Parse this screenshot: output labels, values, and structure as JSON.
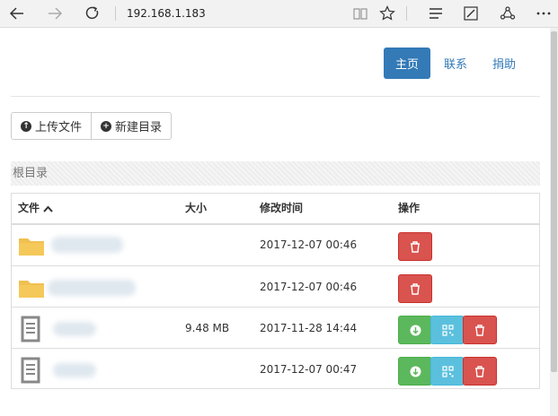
{
  "browser": {
    "address": "192.168.1.183"
  },
  "nav": {
    "home": "主页",
    "contact": "联系",
    "donate": "捐助"
  },
  "toolbar": {
    "upload_label": "上传文件",
    "new_dir_label": "新建目录"
  },
  "breadcrumb": "根目录",
  "table": {
    "headers": [
      "文件",
      "大小",
      "修改时间",
      "操作"
    ],
    "rows": [
      {
        "type": "folder",
        "size": "",
        "time": "2017-12-07 00:46",
        "actions": [
          "delete"
        ]
      },
      {
        "type": "folder",
        "size": "",
        "time": "2017-12-07 00:46",
        "actions": [
          "delete"
        ]
      },
      {
        "type": "file",
        "size": "9.48 MB",
        "time": "2017-11-28 14:44",
        "actions": [
          "download",
          "qrcode",
          "delete"
        ]
      },
      {
        "type": "file",
        "size": "",
        "time": "2017-12-07 00:47",
        "actions": [
          "download",
          "qrcode",
          "delete"
        ]
      }
    ]
  },
  "colors": {
    "primary": "#337ab7",
    "danger": "#d9534f",
    "success": "#5cb85c",
    "info": "#5bc0de",
    "folder": "#f0c050"
  }
}
